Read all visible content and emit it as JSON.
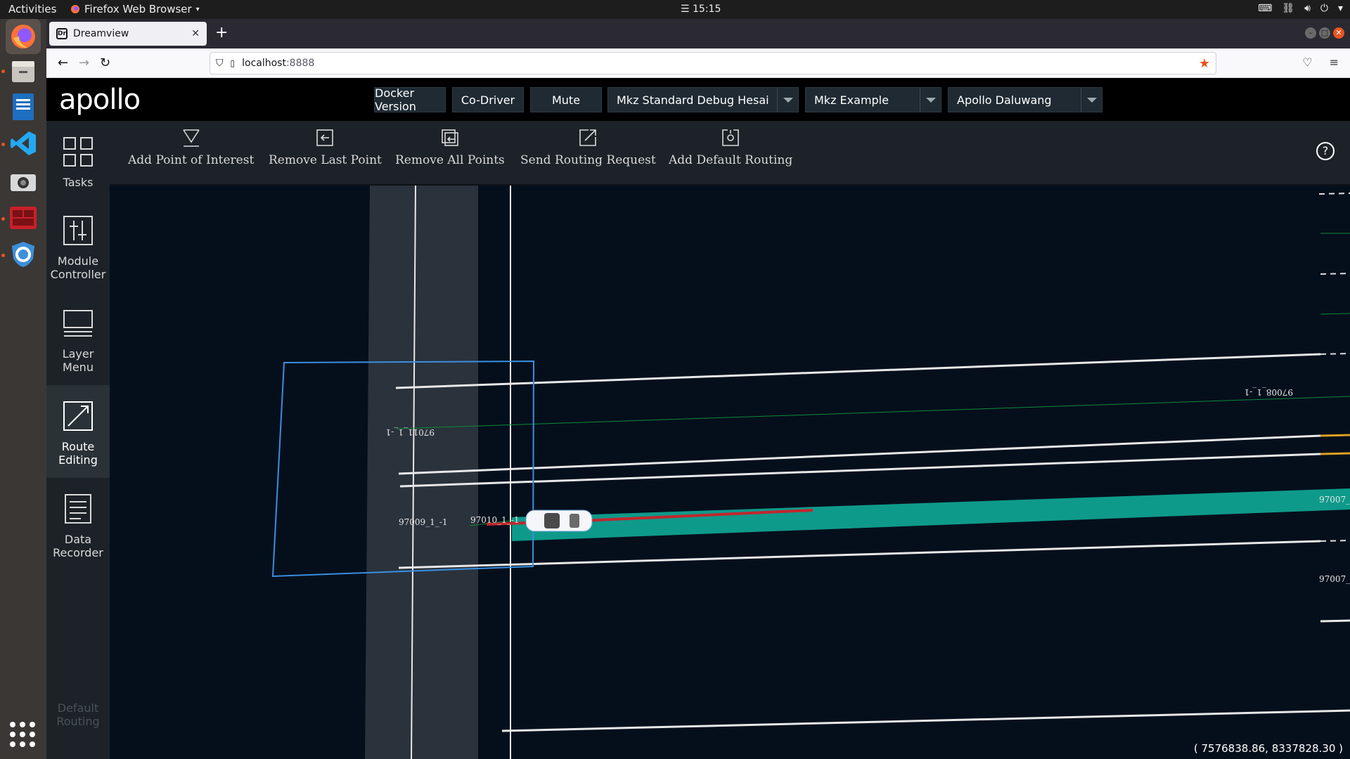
{
  "system_bar": {
    "activities": "Activities",
    "app_name": "Firefox Web Browser",
    "clock": "15:15"
  },
  "browser": {
    "tab_title": "Dreamview",
    "tab_favicon": "Dr",
    "url_host": "localhost",
    "url_port": ":8888"
  },
  "header": {
    "logo": "apollo",
    "buttons": {
      "docker_version": "Docker Version",
      "co_driver": "Co-Driver",
      "mute": "Mute"
    },
    "selects": {
      "vehicle": "Mkz Standard Debug Hesai",
      "map": "Mkz Example",
      "mode": "Apollo Daluwang"
    }
  },
  "sidebar": {
    "items": [
      {
        "label": "Tasks",
        "icon": "tasks-grid-icon"
      },
      {
        "label": "Module Controller",
        "icon": "module-controller-icon"
      },
      {
        "label": "Layer Menu",
        "icon": "layer-menu-icon"
      },
      {
        "label": "Route Editing",
        "icon": "route-editing-icon"
      },
      {
        "label": "Data Recorder",
        "icon": "data-recorder-icon"
      },
      {
        "label": "Default Routing",
        "icon": ""
      }
    ]
  },
  "toolbar": {
    "add_poi": "Add Point of Interest",
    "remove_last": "Remove Last Point",
    "remove_all": "Remove All Points",
    "send_routing": "Send Routing Request",
    "add_default": "Add Default Routing",
    "help": "?"
  },
  "scene": {
    "lane_labels": {
      "l1": "97011_1_-1",
      "l2": "97008_1_-1",
      "l3": "97009_1_-1",
      "l4": "97010_1_-1",
      "l5": "97007_",
      "l6": "97007_"
    },
    "coordinates": "( 7576838.86, 8337828.30 )",
    "colors": {
      "background": "#050f1c",
      "route_highlight": "#0e9a8a",
      "planning_line": "#c0272d",
      "selection_box": "#3a8fe0"
    }
  }
}
